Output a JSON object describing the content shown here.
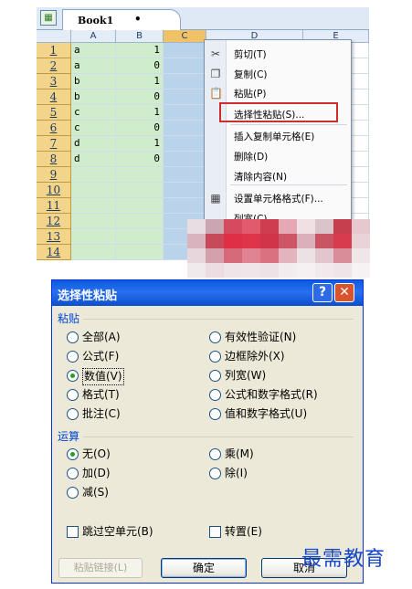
{
  "excel": {
    "book_tab": "Book1",
    "book_tab_marker": "•",
    "columns": [
      "A",
      "B",
      "C",
      "D",
      "E"
    ],
    "rows": [
      {
        "n": "1",
        "a": "a",
        "b": "1"
      },
      {
        "n": "2",
        "a": "a",
        "b": "0"
      },
      {
        "n": "3",
        "a": "b",
        "b": "1"
      },
      {
        "n": "4",
        "a": "b",
        "b": "0"
      },
      {
        "n": "5",
        "a": "c",
        "b": "1"
      },
      {
        "n": "6",
        "a": "c",
        "b": "0"
      },
      {
        "n": "7",
        "a": "d",
        "b": "1"
      },
      {
        "n": "8",
        "a": "d",
        "b": "0"
      },
      {
        "n": "9",
        "a": "",
        "b": ""
      },
      {
        "n": "10",
        "a": "",
        "b": ""
      },
      {
        "n": "11",
        "a": "",
        "b": ""
      },
      {
        "n": "12",
        "a": "",
        "b": ""
      },
      {
        "n": "13",
        "a": "",
        "b": ""
      },
      {
        "n": "14",
        "a": "",
        "b": ""
      }
    ]
  },
  "context_menu": {
    "items": [
      {
        "label": "剪切(T)",
        "icon": "scissors-icon",
        "glyph": "✂"
      },
      {
        "label": "复制(C)",
        "icon": "copy-icon",
        "glyph": "❐"
      },
      {
        "label": "粘贴(P)",
        "icon": "paste-icon",
        "glyph": "📋"
      },
      {
        "label": "选择性粘贴(S)...",
        "icon": "",
        "glyph": ""
      },
      {
        "label": "插入复制单元格(E)",
        "icon": "",
        "glyph": ""
      },
      {
        "label": "删除(D)",
        "icon": "",
        "glyph": ""
      },
      {
        "label": "清除内容(N)",
        "icon": "",
        "glyph": ""
      },
      {
        "label": "设置单元格格式(F)...",
        "icon": "format-cells-icon",
        "glyph": "▦"
      },
      {
        "label": "列宽(C)...",
        "icon": "",
        "glyph": ""
      }
    ]
  },
  "dialog": {
    "title": "选择性粘贴",
    "help_glyph": "?",
    "close_glyph": "✕",
    "paste_section": "粘贴",
    "paste_options_left": [
      "全部(A)",
      "公式(F)",
      "数值(V)",
      "格式(T)",
      "批注(C)"
    ],
    "paste_options_right": [
      "有效性验证(N)",
      "边框除外(X)",
      "列宽(W)",
      "公式和数字格式(R)",
      "值和数字格式(U)"
    ],
    "paste_selected": "数值(V)",
    "operation_section": "运算",
    "operation_left": [
      "无(O)",
      "加(D)",
      "减(S)"
    ],
    "operation_right": [
      "乘(M)",
      "除(I)"
    ],
    "operation_selected": "无(O)",
    "skip_blanks": "跳过空单元(B)",
    "transpose": "转置(E)",
    "paste_link_button": "粘贴链接(L)",
    "ok_button": "确定",
    "cancel_button": "取消"
  },
  "watermark": "最需教育",
  "colors": {
    "title_bar": "#0a5bdd",
    "highlight_box": "#cc2d2d",
    "selected_column": "#b9d3ea",
    "filled_cells": "#cfeccc"
  }
}
